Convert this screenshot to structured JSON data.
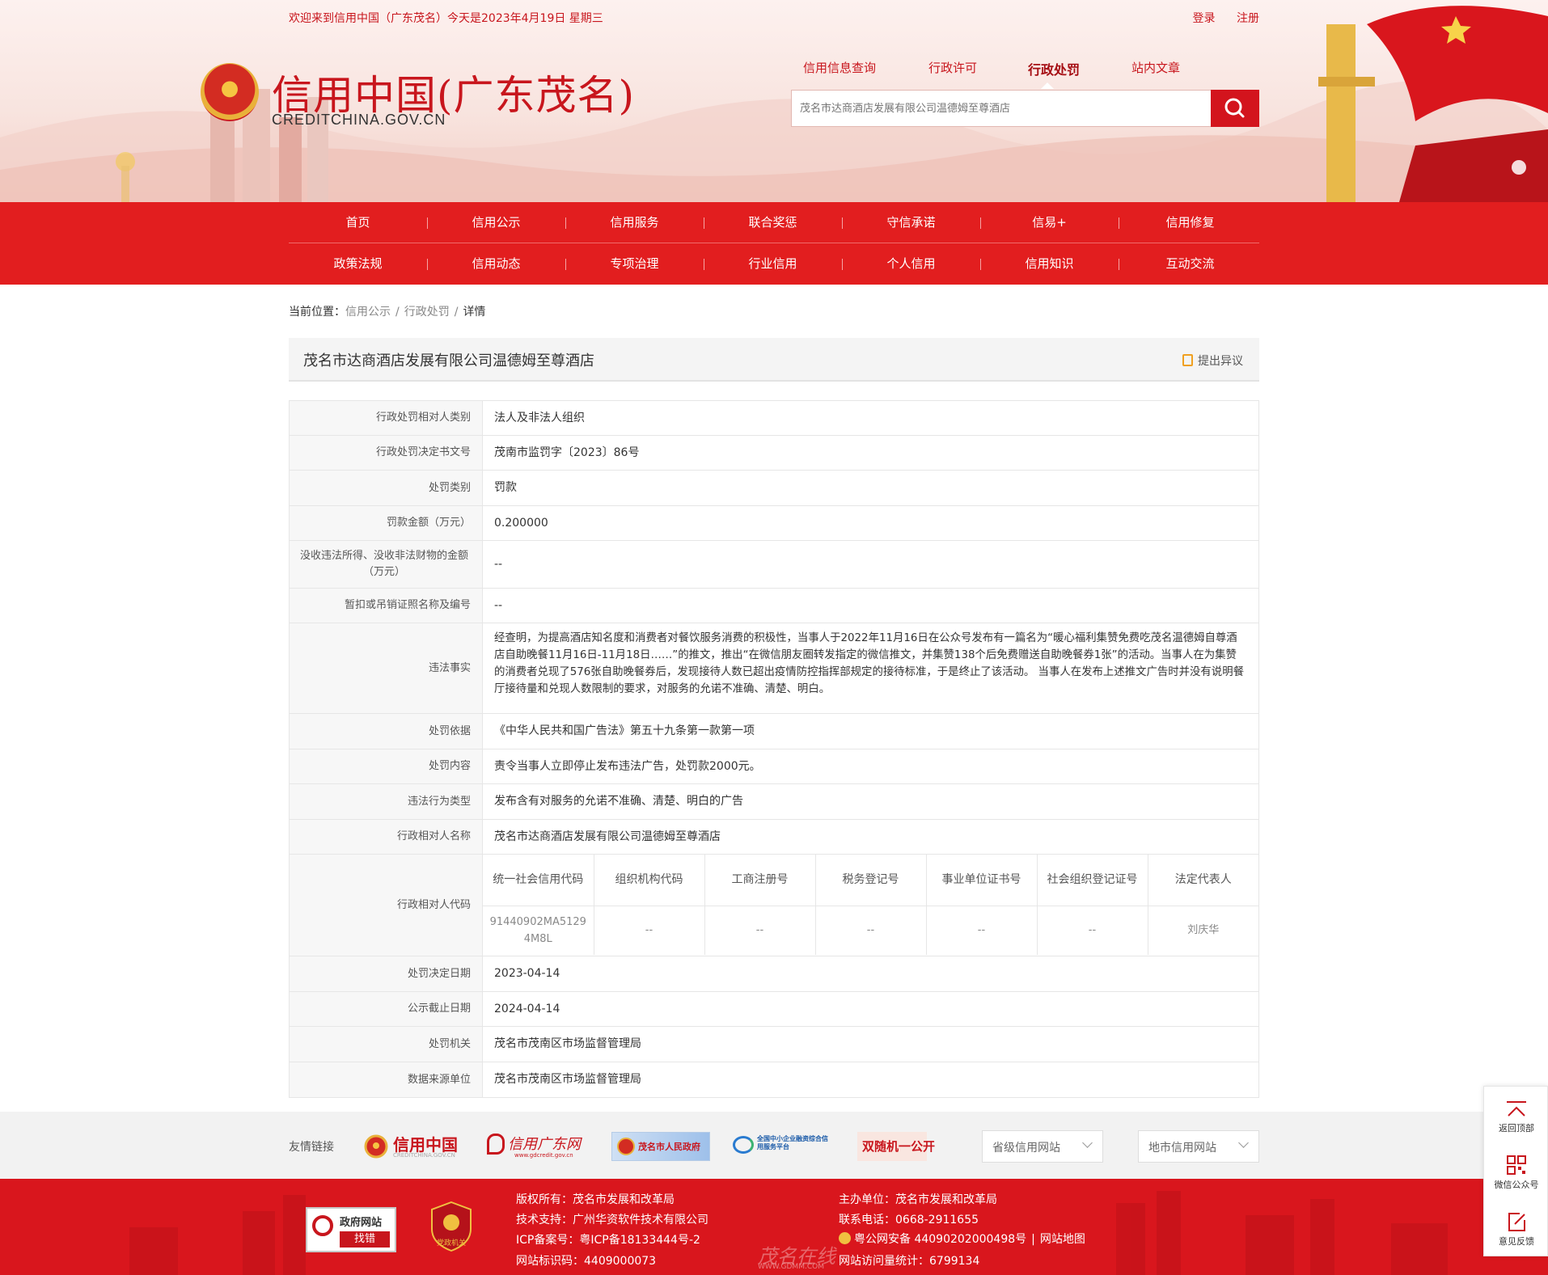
{
  "topbar": {
    "welcome": "欢迎来到信用中国（广东茂名）今天是2023年4月19日 星期三",
    "login": "登录",
    "register": "注册"
  },
  "brand": {
    "title": "信用中国(广东茂名)",
    "domain": "CREDITCHINA.GOV.CN"
  },
  "search_tabs": [
    {
      "label": "信用信息查询"
    },
    {
      "label": "行政许可"
    },
    {
      "label": "行政处罚",
      "active": true
    },
    {
      "label": "站内文章"
    }
  ],
  "search": {
    "placeholder": "茂名市达商酒店发展有限公司温德姆至尊酒店"
  },
  "nav": {
    "row1": [
      "首页",
      "信用公示",
      "信用服务",
      "联合奖惩",
      "守信承诺",
      "信易+",
      "信用修复"
    ],
    "row2": [
      "政策法规",
      "信用动态",
      "专项治理",
      "行业信用",
      "个人信用",
      "信用知识",
      "互动交流"
    ]
  },
  "breadcrumb": {
    "prefix": "当前位置：",
    "items": [
      "信用公示",
      "行政处罚",
      "详情"
    ],
    "sep": "/"
  },
  "detail": {
    "title": "茂名市达商酒店发展有限公司温德姆至尊酒店",
    "objection": "提出异议",
    "rows": [
      {
        "label": "行政处罚相对人类别",
        "value": "法人及非法人组织"
      },
      {
        "label": "行政处罚决定书文号",
        "value": "茂南市监罚字〔2023〕86号"
      },
      {
        "label": "处罚类别",
        "value": "罚款"
      },
      {
        "label": "罚款金额（万元）",
        "value": "0.200000"
      },
      {
        "label": "没收违法所得、没收非法财物的金额（万元）",
        "value": "--"
      },
      {
        "label": "暂扣或吊销证照名称及编号",
        "value": "--"
      },
      {
        "label": "违法事实",
        "value": "经查明，为提高酒店知名度和消费者对餐饮服务消费的积极性，当事人于2022年11月16日在公众号发布有一篇名为“暖心福利集赞免费吃茂名温德姆自尊酒店自助晚餐11月16日-11月18日……”的推文，推出“在微信朋友圈转发指定的微信推文，并集赞138个后免费赠送自助晚餐券1张”的活动。当事人在为集赞的消费者兑现了576张自助晚餐券后，发现接待人数已超出疫情防控指挥部规定的接待标准，于是终止了该活动。 当事人在发布上述推文广告时并没有说明餐厅接待量和兑现人数限制的要求，对服务的允诺不准确、清楚、明白。"
      },
      {
        "label": "处罚依据",
        "value": "《中华人民共和国广告法》第五十九条第一款第一项"
      },
      {
        "label": "处罚内容",
        "value": "责令当事人立即停止发布违法广告，处罚款2000元。"
      },
      {
        "label": "违法行为类型",
        "value": "发布含有对服务的允诺不准确、清楚、明白的广告"
      },
      {
        "label": "行政相对人名称",
        "value": "茂名市达商酒店发展有限公司温德姆至尊酒店"
      }
    ],
    "code_label": "行政相对人代码",
    "code_headers": [
      "统一社会信用代码",
      "组织机构代码",
      "工商注册号",
      "税务登记号",
      "事业单位证书号",
      "社会组织登记证号",
      "法定代表人"
    ],
    "code_values": [
      "91440902MA51294M8L",
      "--",
      "--",
      "--",
      "--",
      "--",
      "刘庆华"
    ],
    "rows2": [
      {
        "label": "处罚决定日期",
        "value": "2023-04-14"
      },
      {
        "label": "公示截止日期",
        "value": "2024-04-14"
      },
      {
        "label": "处罚机关",
        "value": "茂名市茂南区市场监督管理局"
      },
      {
        "label": "数据来源单位",
        "value": "茂名市茂南区市场监督管理局"
      }
    ]
  },
  "side": {
    "top": "返回顶部",
    "wechat": "微信公众号",
    "feedback": "意见反馈"
  },
  "links": {
    "label": "友情链接",
    "logos": [
      "信用中国",
      "信用广东网",
      "茂名市人民政府",
      "全国中小企业融资综合信用服务平台",
      "双随机一公开"
    ],
    "logo_sub": [
      "CREDITCHINA.GOV.CN",
      "www.gdcredit.gov.cn",
      "",
      "",
      ""
    ],
    "select1": "省级信用网站",
    "select2": "地市信用网站"
  },
  "footer": {
    "badge1_top": "政府网站",
    "badge1_bottom": "找错",
    "badge2": "党政机关",
    "copyright": "版权所有：茂名市发展和改革局",
    "tech": "技术支持：广州华资软件技术有限公司",
    "icp": "ICP备案号：粤ICP备18133444号-2",
    "site_id": "网站标识码：4409000073",
    "host": "主办单位：茂名市发展和改革局",
    "phone": "联系电话：0668-2911655",
    "police": "粤公网安备 44090202000498号",
    "sitemap": "网站地图",
    "visits": "网站访问量统计：6799134",
    "watermark": "茂名在线",
    "watermark_url": "WWW.GDMM.COM"
  }
}
